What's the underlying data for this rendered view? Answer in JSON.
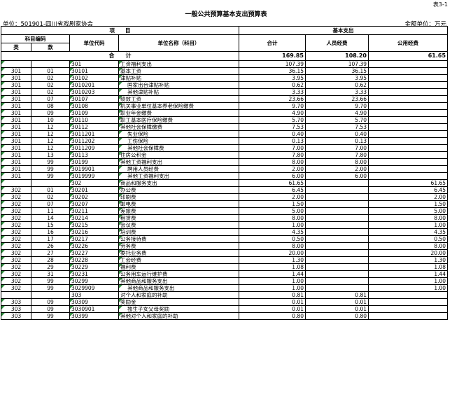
{
  "form_no": "表3-1",
  "title": "一般公共预算基本支出预算表",
  "unit_left": "单位：501901-四川省戏剧家协会",
  "unit_right": "金额单位：万元",
  "headers": {
    "project": "项　　目",
    "basic_expense": "基本支出",
    "subject_code": "科目编码",
    "lei": "类",
    "kuan": "款",
    "unit_code": "单位代码",
    "unit_name": "单位名称（科目）",
    "total": "合计",
    "personnel": "人员经费",
    "public": "公用经费"
  },
  "total_row": {
    "label": "合　　计",
    "total": "169.85",
    "personnel": "108.20",
    "public": "61.65"
  },
  "rows": [
    {
      "lei": "",
      "kuan": "",
      "code": "301",
      "name": "工资福利支出",
      "indent": false,
      "mark": true,
      "total": "107.39",
      "personnel": "107.39",
      "public": ""
    },
    {
      "lei": "301",
      "kuan": "01",
      "code": "30101",
      "name": "基本工资",
      "indent": false,
      "mark": true,
      "total": "36.15",
      "personnel": "36.15",
      "public": ""
    },
    {
      "lei": "301",
      "kuan": "02",
      "code": "30102",
      "name": "津贴补贴",
      "indent": false,
      "mark": true,
      "total": "3.95",
      "personnel": "3.95",
      "public": ""
    },
    {
      "lei": "301",
      "kuan": "02",
      "code": "3010201",
      "name": "国家出台津贴补贴",
      "indent": true,
      "mark": true,
      "total": "0.62",
      "personnel": "0.62",
      "public": ""
    },
    {
      "lei": "301",
      "kuan": "02",
      "code": "3010203",
      "name": "其他津贴补贴",
      "indent": true,
      "mark": true,
      "total": "3.33",
      "personnel": "3.33",
      "public": ""
    },
    {
      "lei": "301",
      "kuan": "07",
      "code": "30107",
      "name": "绩效工资",
      "indent": false,
      "mark": true,
      "total": "23.66",
      "personnel": "23.66",
      "public": ""
    },
    {
      "lei": "301",
      "kuan": "08",
      "code": "30108",
      "name": "机关事业单位基本养老保险缴费",
      "indent": false,
      "mark": true,
      "total": "9.70",
      "personnel": "9.70",
      "public": ""
    },
    {
      "lei": "301",
      "kuan": "09",
      "code": "30109",
      "name": "职业年金缴费",
      "indent": false,
      "mark": true,
      "total": "4.90",
      "personnel": "4.90",
      "public": ""
    },
    {
      "lei": "301",
      "kuan": "10",
      "code": "30110",
      "name": "职工基本医疗保险缴费",
      "indent": false,
      "mark": true,
      "total": "5.70",
      "personnel": "5.70",
      "public": ""
    },
    {
      "lei": "301",
      "kuan": "12",
      "code": "30112",
      "name": "其他社会保障缴费",
      "indent": false,
      "mark": true,
      "total": "7.53",
      "personnel": "7.53",
      "public": ""
    },
    {
      "lei": "301",
      "kuan": "12",
      "code": "3011201",
      "name": "失业保险",
      "indent": true,
      "mark": true,
      "total": "0.40",
      "personnel": "0.40",
      "public": ""
    },
    {
      "lei": "301",
      "kuan": "12",
      "code": "3011202",
      "name": "工伤保险",
      "indent": true,
      "mark": true,
      "total": "0.13",
      "personnel": "0.13",
      "public": ""
    },
    {
      "lei": "301",
      "kuan": "12",
      "code": "3011209",
      "name": "其他社会保障费",
      "indent": true,
      "mark": true,
      "total": "7.00",
      "personnel": "7.00",
      "public": ""
    },
    {
      "lei": "301",
      "kuan": "13",
      "code": "30113",
      "name": "住房公积金",
      "indent": false,
      "mark": true,
      "total": "7.80",
      "personnel": "7.80",
      "public": ""
    },
    {
      "lei": "301",
      "kuan": "99",
      "code": "30199",
      "name": "其他工资福利支出",
      "indent": false,
      "mark": true,
      "total": "8.00",
      "personnel": "8.00",
      "public": ""
    },
    {
      "lei": "301",
      "kuan": "99",
      "code": "3019901",
      "name": "聘用人员经费",
      "indent": true,
      "mark": true,
      "total": "2.00",
      "personnel": "2.00",
      "public": ""
    },
    {
      "lei": "301",
      "kuan": "99",
      "code": "3019999",
      "name": "其他工资福利支出",
      "indent": true,
      "mark": true,
      "total": "6.00",
      "personnel": "6.00",
      "public": ""
    },
    {
      "lei": "",
      "kuan": "",
      "code": "302",
      "name": "商品和服务支出",
      "indent": false,
      "mark": true,
      "total": "61.65",
      "personnel": "",
      "public": "61.65"
    },
    {
      "lei": "302",
      "kuan": "01",
      "code": "30201",
      "name": "办公费",
      "indent": false,
      "mark": true,
      "total": "6.45",
      "personnel": "",
      "public": "6.45"
    },
    {
      "lei": "302",
      "kuan": "02",
      "code": "30202",
      "name": "印刷费",
      "indent": false,
      "mark": true,
      "total": "2.00",
      "personnel": "",
      "public": "2.00"
    },
    {
      "lei": "302",
      "kuan": "07",
      "code": "30207",
      "name": "邮电费",
      "indent": false,
      "mark": true,
      "total": "1.50",
      "personnel": "",
      "public": "1.50"
    },
    {
      "lei": "302",
      "kuan": "11",
      "code": "30211",
      "name": "差旅费",
      "indent": false,
      "mark": true,
      "total": "5.00",
      "personnel": "",
      "public": "5.00"
    },
    {
      "lei": "302",
      "kuan": "14",
      "code": "30214",
      "name": "租赁费",
      "indent": false,
      "mark": true,
      "total": "8.00",
      "personnel": "",
      "public": "8.00"
    },
    {
      "lei": "302",
      "kuan": "15",
      "code": "30215",
      "name": "会议费",
      "indent": false,
      "mark": true,
      "total": "1.00",
      "personnel": "",
      "public": "1.00"
    },
    {
      "lei": "302",
      "kuan": "16",
      "code": "30216",
      "name": "培训费",
      "indent": false,
      "mark": true,
      "total": "4.35",
      "personnel": "",
      "public": "4.35"
    },
    {
      "lei": "302",
      "kuan": "17",
      "code": "30217",
      "name": "公务接待费",
      "indent": false,
      "mark": true,
      "total": "0.50",
      "personnel": "",
      "public": "0.50"
    },
    {
      "lei": "302",
      "kuan": "26",
      "code": "30226",
      "name": "劳务费",
      "indent": false,
      "mark": true,
      "total": "8.00",
      "personnel": "",
      "public": "8.00"
    },
    {
      "lei": "302",
      "kuan": "27",
      "code": "30227",
      "name": "委托业务费",
      "indent": false,
      "mark": true,
      "total": "20.00",
      "personnel": "",
      "public": "20.00"
    },
    {
      "lei": "302",
      "kuan": "28",
      "code": "30228",
      "name": "工会经费",
      "indent": false,
      "mark": true,
      "total": "1.30",
      "personnel": "",
      "public": "1.30"
    },
    {
      "lei": "302",
      "kuan": "29",
      "code": "30229",
      "name": "福利费",
      "indent": false,
      "mark": true,
      "total": "1.08",
      "personnel": "",
      "public": "1.08"
    },
    {
      "lei": "302",
      "kuan": "31",
      "code": "30231",
      "name": "公务用车运行维护费",
      "indent": false,
      "mark": true,
      "total": "1.44",
      "personnel": "",
      "public": "1.44"
    },
    {
      "lei": "302",
      "kuan": "99",
      "code": "30299",
      "name": "其他商品和服务支出",
      "indent": false,
      "mark": true,
      "total": "1.00",
      "personnel": "",
      "public": "1.00"
    },
    {
      "lei": "302",
      "kuan": "99",
      "code": "3029909",
      "name": "其他商品和服务支出",
      "indent": true,
      "mark": true,
      "total": "1.00",
      "personnel": "",
      "public": "1.00"
    },
    {
      "lei": "",
      "kuan": "",
      "code": "303",
      "name": "对个人和家庭的补助",
      "indent": false,
      "mark": false,
      "total": "0.81",
      "personnel": "0.81",
      "public": ""
    },
    {
      "lei": "303",
      "kuan": "09",
      "code": "30309",
      "name": "奖励金",
      "indent": false,
      "mark": true,
      "total": "0.01",
      "personnel": "0.01",
      "public": ""
    },
    {
      "lei": "303",
      "kuan": "09",
      "code": "3030901",
      "name": "独生子女父母奖励",
      "indent": true,
      "mark": true,
      "total": "0.01",
      "personnel": "0.01",
      "public": ""
    },
    {
      "lei": "303",
      "kuan": "99",
      "code": "30399",
      "name": "其他对个人和家庭的补助",
      "indent": false,
      "mark": true,
      "total": "0.80",
      "personnel": "0.80",
      "public": ""
    }
  ]
}
